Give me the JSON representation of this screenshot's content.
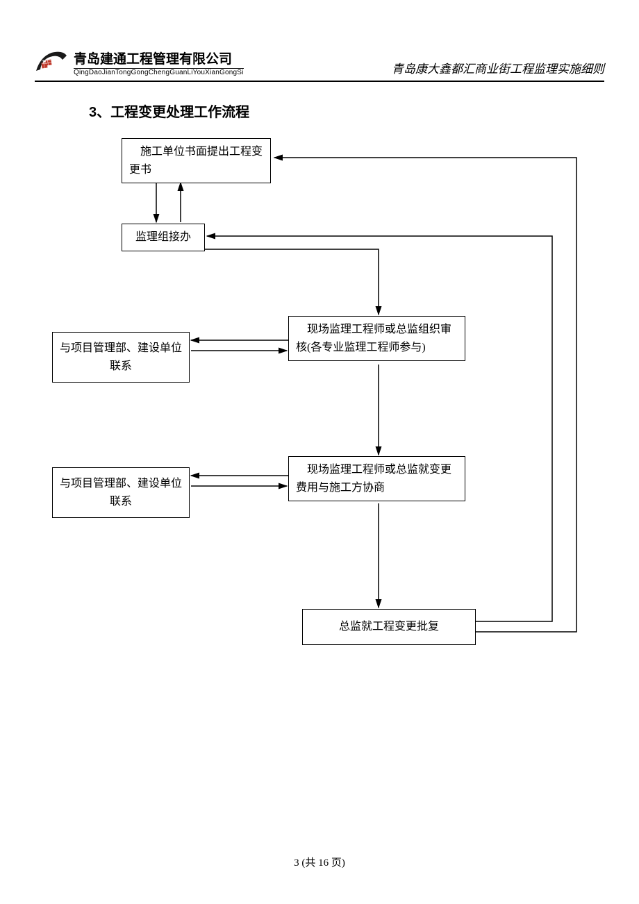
{
  "header": {
    "company_name": "青岛建通工程管理有限公司",
    "company_pinyin": "QingDaoJianTongGongChengGuanLiYouXianGongSi",
    "doc_title": "青岛康大鑫都汇商业街工程监理实施细则"
  },
  "section_title": "3、工程变更处理工作流程",
  "diagram": {
    "box1": "　施工单位书面提出工程变更书",
    "box2": "监理组接办",
    "box3": "与项目管理部、建设单位联系",
    "box4": "　现场监理工程师或总监组织审核(各专业监理工程师参与)",
    "box5": "与项目管理部、建设单位联系",
    "box6": "　现场监理工程师或总监就变更费用与施工方协商",
    "box7": "总监就工程变更批复"
  },
  "footer": "3 (共 16 页)",
  "chart_data": {
    "type": "flowchart",
    "title": "工程变更处理工作流程",
    "nodes": [
      {
        "id": "n1",
        "label": "施工单位书面提出工程变更书"
      },
      {
        "id": "n2",
        "label": "监理组接办"
      },
      {
        "id": "n3",
        "label": "与项目管理部、建设单位联系"
      },
      {
        "id": "n4",
        "label": "现场监理工程师或总监组织审核(各专业监理工程师参与)"
      },
      {
        "id": "n5",
        "label": "与项目管理部、建设单位联系"
      },
      {
        "id": "n6",
        "label": "现场监理工程师或总监就变更费用与施工方协商"
      },
      {
        "id": "n7",
        "label": "总监就工程变更批复"
      }
    ],
    "edges": [
      {
        "from": "n1",
        "to": "n2",
        "bidirectional": true
      },
      {
        "from": "n2",
        "to": "n4"
      },
      {
        "from": "n4",
        "to": "n3",
        "bidirectional": true
      },
      {
        "from": "n4",
        "to": "n6"
      },
      {
        "from": "n6",
        "to": "n5",
        "bidirectional": true
      },
      {
        "from": "n6",
        "to": "n7"
      },
      {
        "from": "n7",
        "to": "n2",
        "feedback": true
      },
      {
        "from": "n7",
        "to": "n1",
        "feedback": true
      }
    ]
  }
}
